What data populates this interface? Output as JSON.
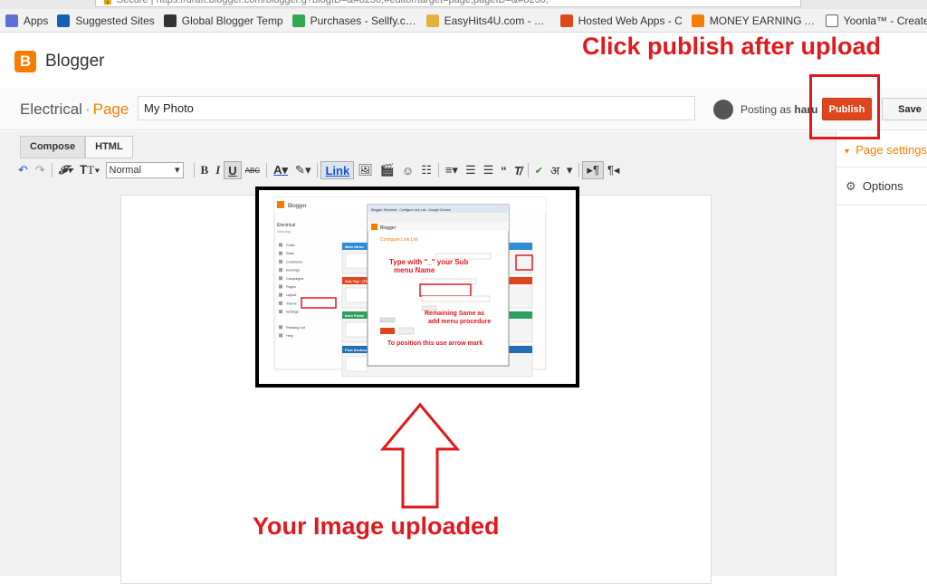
{
  "browser": {
    "address_url": "🔒 Secure | https://draft.blogger.com/blogger.g?blogID=&#8230;#editor/target=page;pageID=&#8230;",
    "bookmarks": [
      {
        "label": "Apps",
        "color": "#5f6fd6"
      },
      {
        "label": "Suggested Sites",
        "color": "#1a5fb4"
      },
      {
        "label": "Global Blogger Temp",
        "color": "#333333"
      },
      {
        "label": "Purchases - Sellfy.com",
        "color": "#33a853"
      },
      {
        "label": "EasyHits4U.com - You",
        "color": "#e2b33a"
      },
      {
        "label": "Hosted Web Apps - C",
        "color": "#e0461e"
      },
      {
        "label": "MONEY EARNING AP",
        "color": "#f57d00"
      },
      {
        "label": "Yoonla™ - Create a L",
        "color": "#ffffff"
      }
    ]
  },
  "app": {
    "logo_letter": "B",
    "name": "Blogger",
    "accent": "#f57d00"
  },
  "header": {
    "blog_name": "Electrical",
    "separator": "·",
    "section": "Page",
    "post_title": "My Photo",
    "posting_as_label": "Posting as",
    "posting_as_user": "haru",
    "publish_label": "Publish",
    "save_label": "Save"
  },
  "editor": {
    "tabs": [
      {
        "label": "Compose",
        "active": true
      },
      {
        "label": "HTML",
        "active": false
      }
    ],
    "font_value": "Normal",
    "link_label": "Link",
    "hindi_glyph": "अ"
  },
  "sidebar": {
    "page_settings_label": "Page settings",
    "options_label": "Options"
  },
  "annotations": {
    "publish_hint": "Click publish after upload",
    "uploaded_hint": "Your Image uploaded",
    "annot_color": "#e0191e"
  },
  "embedded_screenshot": {
    "app_name": "Blogger",
    "blog_name": "Electrical",
    "view_blog": "View blog",
    "dialog_title": "Blogger: Electrical - Configure Link List - Google Chrome",
    "dialog_heading": "Configure Link List",
    "nav_items": [
      "Posts",
      "Stats",
      "Comments",
      "Earnings",
      "Campaigns",
      "Pages",
      "Layout",
      "Theme",
      "Settings",
      "Reading List",
      "Help"
    ],
    "panel_titles": [
      "Main Menu",
      "Sub Top : (TB)",
      "Intro Posts",
      "Post Section"
    ],
    "note_sub_menu": "Type with \"_\" your Sub menu Name",
    "note_remaining": "Remaining Same as add menu procedure",
    "note_position": "To position this use arrow mark"
  }
}
